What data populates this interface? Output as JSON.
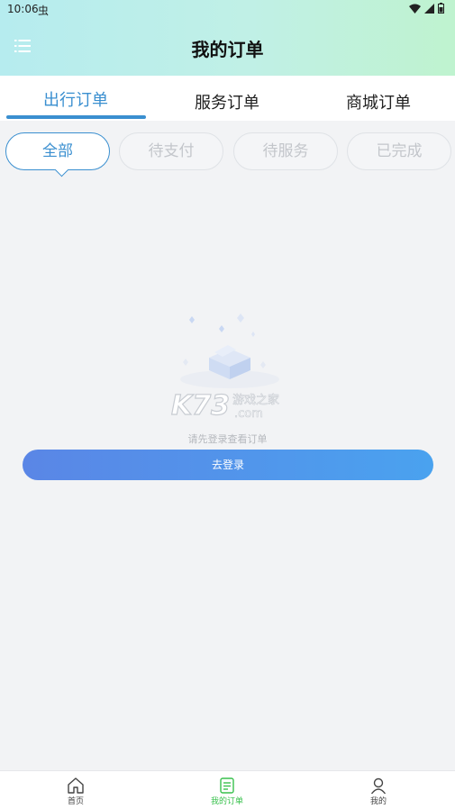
{
  "status_bar": {
    "time": "10:06",
    "debug_glyph": "虫"
  },
  "header": {
    "title": "我的订单",
    "menu_icon": "list-menu-icon"
  },
  "tabs": [
    {
      "label": "出行订单",
      "active": true
    },
    {
      "label": "服务订单",
      "active": false
    },
    {
      "label": "商城订单",
      "active": false
    }
  ],
  "filters": [
    {
      "label": "全部",
      "active": true
    },
    {
      "label": "待支付",
      "active": false
    },
    {
      "label": "待服务",
      "active": false
    },
    {
      "label": "已完成",
      "active": false
    }
  ],
  "empty_state": {
    "illustration": "empty-box-icon",
    "watermark_main": "K73",
    "watermark_sub": "游戏之家",
    "watermark_domain": ".com",
    "message": "请先登录查看订单",
    "button_label": "去登录"
  },
  "bottom_nav": [
    {
      "label": "首页",
      "icon": "home-icon",
      "active": false
    },
    {
      "label": "我的订单",
      "icon": "orders-icon",
      "active": true
    },
    {
      "label": "我的",
      "icon": "user-icon",
      "active": false
    }
  ],
  "colors": {
    "accent_blue": "#3a8fd0",
    "active_green": "#39c14d",
    "button_gradient_start": "#5a86e6",
    "button_gradient_end": "#4aa2ef"
  }
}
